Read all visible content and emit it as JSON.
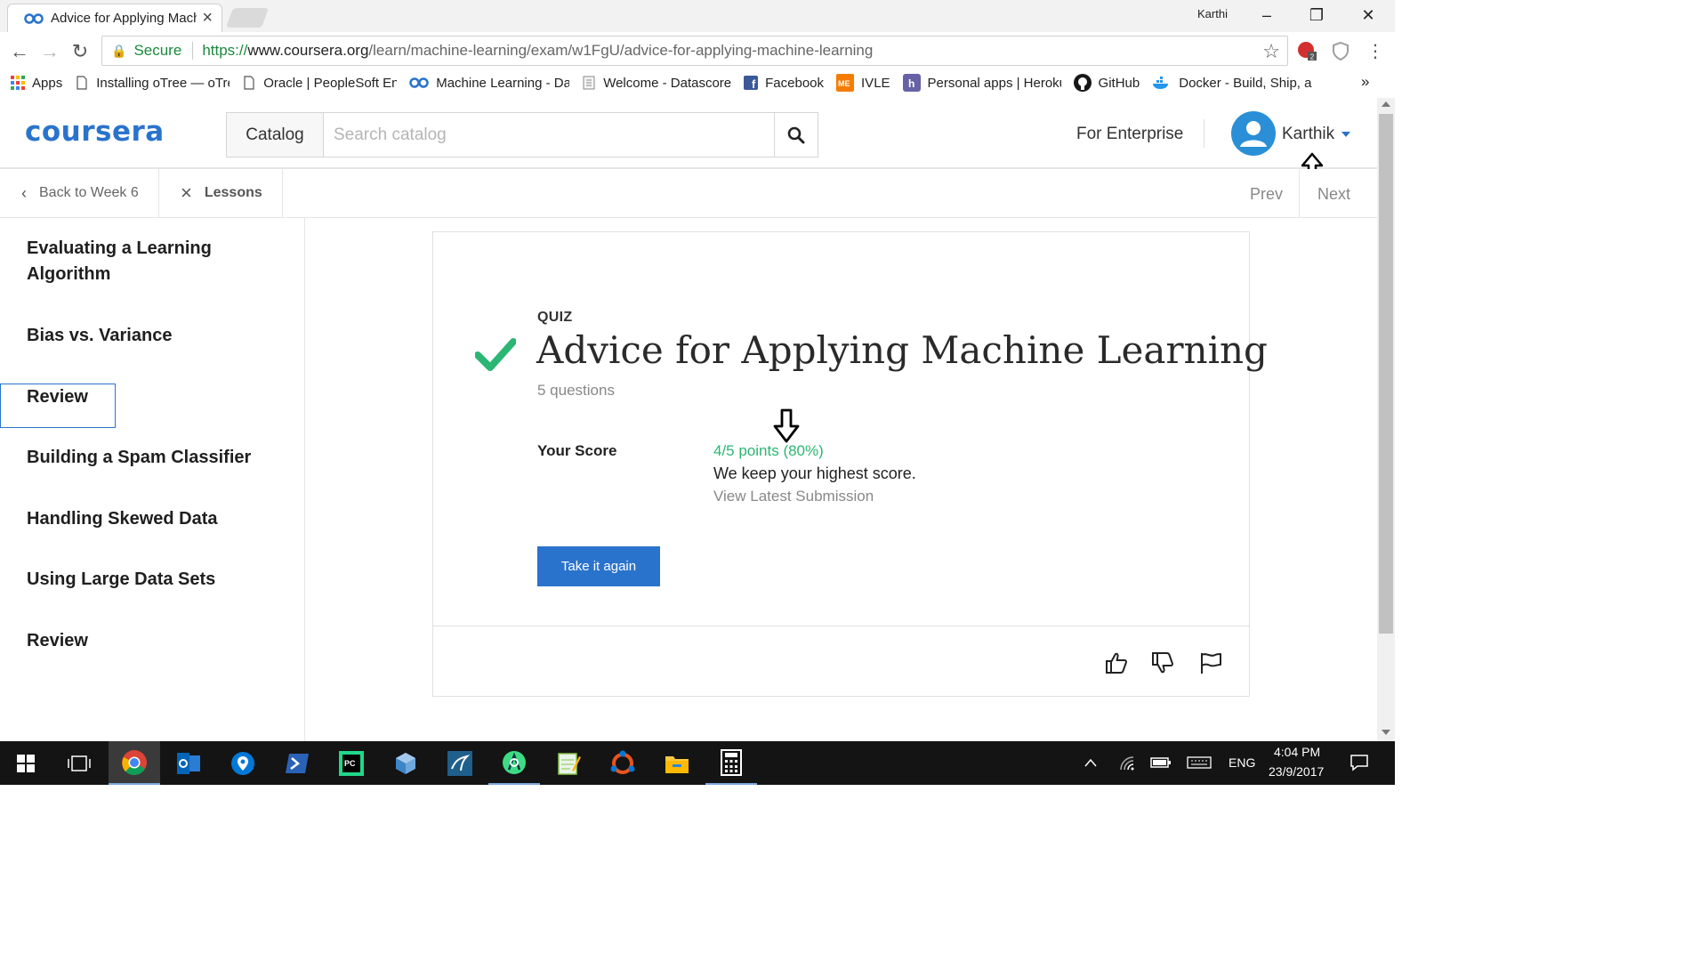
{
  "browser": {
    "tab_title": "Advice for Applying Machine Learning",
    "user": "Karthi",
    "secure_label": "Secure",
    "url_scheme": "https://",
    "url_host": "www.coursera.org",
    "url_path": "/learn/machine-learning/exam/w1FgU/advice-for-applying-machine-learning",
    "extension_badge": "2",
    "bookmarks": [
      {
        "label": "Apps",
        "icon": "apps-grid-icon"
      },
      {
        "label": "Installing oTree — oTree",
        "icon": "page-icon"
      },
      {
        "label": "Oracle | PeopleSoft Enterprise",
        "icon": "page-icon"
      },
      {
        "label": "Machine Learning - Dashboard",
        "icon": "coursera-icon"
      },
      {
        "label": "Welcome - Datascore",
        "icon": "document-icon"
      },
      {
        "label": "Facebook",
        "icon": "facebook-icon"
      },
      {
        "label": "IVLE",
        "icon": "ivle-icon"
      },
      {
        "label": "Personal apps | Heroku",
        "icon": "heroku-icon"
      },
      {
        "label": "GitHub",
        "icon": "github-icon"
      },
      {
        "label": "Docker - Build, Ship, and Run",
        "icon": "docker-icon"
      }
    ],
    "bookmarks_overflow": "»"
  },
  "header": {
    "logo": "coursera",
    "catalog_label": "Catalog",
    "search_placeholder": "Search catalog",
    "enterprise_label": "For Enterprise",
    "user_name": "Karthik"
  },
  "subnav": {
    "back_label": "Back to Week 6",
    "lessons_label": "Lessons",
    "prev_label": "Prev",
    "next_label": "Next"
  },
  "sidebar": {
    "items": [
      {
        "label": "Evaluating a Learning Algorithm"
      },
      {
        "label": "Bias vs. Variance"
      },
      {
        "label": "Review"
      },
      {
        "label": "Building a Spam Classifier"
      },
      {
        "label": "Handling Skewed Data"
      },
      {
        "label": "Using Large Data Sets"
      },
      {
        "label": "Review"
      }
    ]
  },
  "quiz": {
    "type_label": "QUIZ",
    "title": "Advice for Applying Machine Learning",
    "question_count": "5 questions",
    "score_label": "Your Score",
    "score_value": "4/5 points (80%)",
    "score_note": "We keep your highest score.",
    "view_latest": "View Latest Submission",
    "retake_label": "Take it again"
  },
  "taskbar": {
    "lang": "ENG",
    "time": "4:04 PM",
    "date": "23/9/2017"
  },
  "colors": {
    "brand": "#2a73cc",
    "success": "#2bb673",
    "taskbar": "#141414"
  }
}
